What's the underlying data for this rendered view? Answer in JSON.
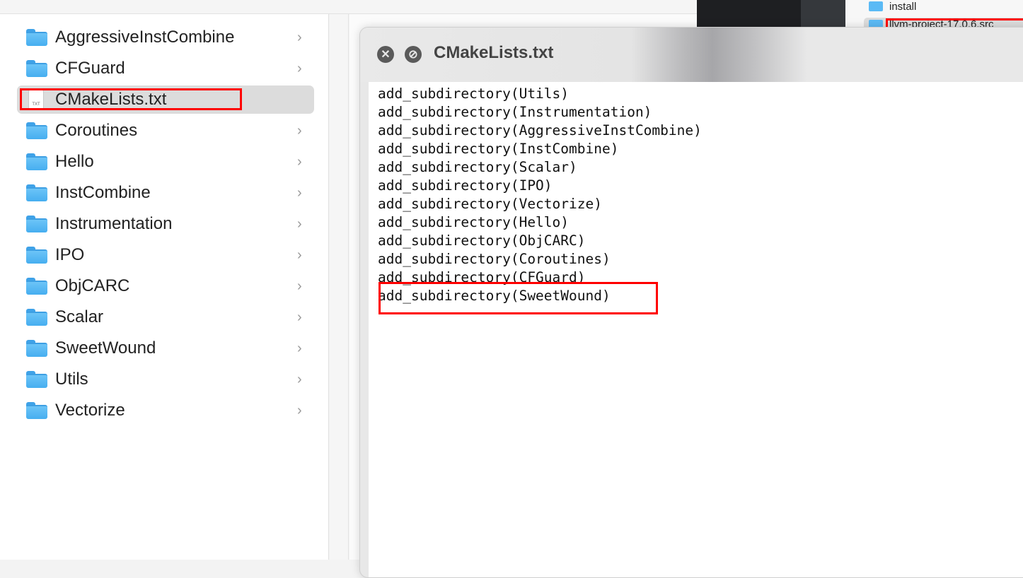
{
  "finder": {
    "items": [
      {
        "name": "AggressiveInstCombine",
        "type": "folder"
      },
      {
        "name": "CFGuard",
        "type": "folder"
      },
      {
        "name": "CMakeLists.txt",
        "type": "file",
        "selected": true,
        "file_badge": "TXT"
      },
      {
        "name": "Coroutines",
        "type": "folder"
      },
      {
        "name": "Hello",
        "type": "folder"
      },
      {
        "name": "InstCombine",
        "type": "folder"
      },
      {
        "name": "Instrumentation",
        "type": "folder"
      },
      {
        "name": "IPO",
        "type": "folder"
      },
      {
        "name": "ObjCARC",
        "type": "folder"
      },
      {
        "name": "Scalar",
        "type": "folder"
      },
      {
        "name": "SweetWound",
        "type": "folder"
      },
      {
        "name": "Utils",
        "type": "folder"
      },
      {
        "name": "Vectorize",
        "type": "folder"
      }
    ],
    "chevron": "›"
  },
  "background_finder": {
    "items": [
      "install",
      "llvm-project-17.0.6.src"
    ]
  },
  "quicklook": {
    "title": "CMakeLists.txt",
    "close_icon": "✕",
    "fullscreen_icon": "⊘",
    "lines": [
      "add_subdirectory(Utils)",
      "add_subdirectory(Instrumentation)",
      "add_subdirectory(AggressiveInstCombine)",
      "add_subdirectory(InstCombine)",
      "add_subdirectory(Scalar)",
      "add_subdirectory(IPO)",
      "add_subdirectory(Vectorize)",
      "add_subdirectory(Hello)",
      "add_subdirectory(ObjCARC)",
      "add_subdirectory(Coroutines)",
      "add_subdirectory(CFGuard)",
      "add_subdirectory(SweetWound)"
    ]
  },
  "colors": {
    "highlight": "#ff0000",
    "folder": "#5bbaf5"
  }
}
